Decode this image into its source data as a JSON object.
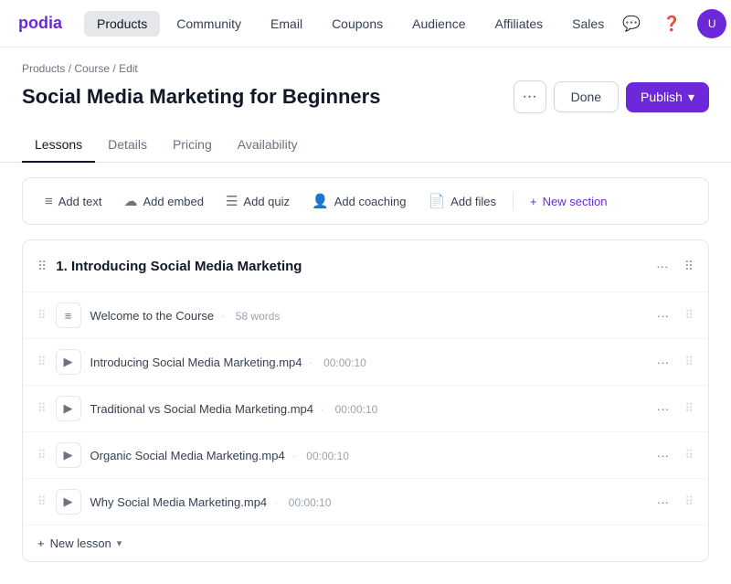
{
  "logo": "podia",
  "nav": {
    "items": [
      {
        "label": "Products",
        "active": true
      },
      {
        "label": "Community",
        "active": false
      },
      {
        "label": "Email",
        "active": false
      },
      {
        "label": "Coupons",
        "active": false
      },
      {
        "label": "Audience",
        "active": false
      },
      {
        "label": "Affiliates",
        "active": false
      },
      {
        "label": "Sales",
        "active": false
      }
    ]
  },
  "breadcrumb": {
    "items": [
      "Products",
      "Course",
      "Edit"
    ]
  },
  "page": {
    "title": "Social Media Marketing for Beginners"
  },
  "actions": {
    "more_label": "···",
    "done_label": "Done",
    "publish_label": "Publish",
    "publish_chevron": "▾"
  },
  "tabs": [
    {
      "label": "Lessons",
      "active": true
    },
    {
      "label": "Details",
      "active": false
    },
    {
      "label": "Pricing",
      "active": false
    },
    {
      "label": "Availability",
      "active": false
    }
  ],
  "toolbar": {
    "buttons": [
      {
        "icon": "≡",
        "label": "Add text"
      },
      {
        "icon": "☁",
        "label": "Add embed"
      },
      {
        "icon": "☰",
        "label": "Add quiz"
      },
      {
        "icon": "👤",
        "label": "Add coaching"
      },
      {
        "icon": "📄",
        "label": "Add files"
      }
    ],
    "new_section_label": "New section"
  },
  "section": {
    "title": "1. Introducing Social Media Marketing",
    "lessons": [
      {
        "icon_type": "text",
        "name": "Welcome to the Course",
        "meta": "58 words"
      },
      {
        "icon_type": "video",
        "name": "Introducing Social Media Marketing.mp4",
        "meta": "00:00:10"
      },
      {
        "icon_type": "video",
        "name": "Traditional vs Social Media Marketing.mp4",
        "meta": "00:00:10"
      },
      {
        "icon_type": "video",
        "name": "Organic Social Media Marketing.mp4",
        "meta": "00:00:10"
      },
      {
        "icon_type": "video",
        "name": "Why Social Media Marketing.mp4",
        "meta": "00:00:10"
      }
    ],
    "new_lesson_label": "New lesson"
  },
  "icons": {
    "drag": "⠿",
    "more": "···",
    "plus": "+",
    "chevron_down": "▾",
    "text_icon": "≡",
    "video_icon": "▶"
  }
}
